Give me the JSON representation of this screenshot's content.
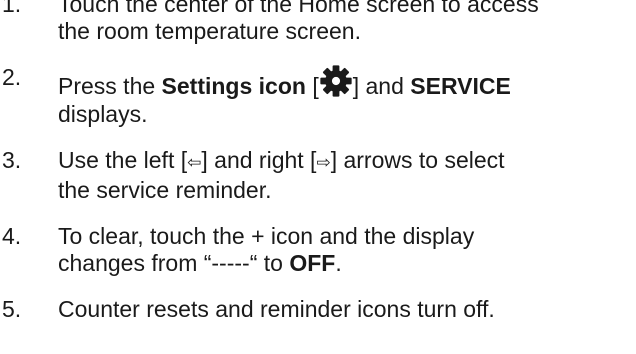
{
  "steps": [
    {
      "number": "1.",
      "line1": "Touch the center of the Home screen to access",
      "line2": "the room temperature screen."
    },
    {
      "number": "2.",
      "line1_a": "Press the ",
      "line1_bold1": "Settings icon",
      "line1_b": " [",
      "icon": "gear-icon",
      "line1_c": "] and ",
      "line1_bold2": "SERVICE",
      "line2": "displays."
    },
    {
      "number": "3.",
      "line1_a": "Use the left [",
      "left_arrow": "⇦",
      "line1_b": "] and right [",
      "right_arrow": "⇨",
      "line1_c": "] arrows to select",
      "line2": "the service reminder."
    },
    {
      "number": "4.",
      "line1": "To clear, touch the + icon and the display",
      "line2_a": "changes from “-----“ to ",
      "line2_bold": "OFF",
      "line2_b": "."
    },
    {
      "number": "5.",
      "line1": "Counter resets and reminder icons turn off."
    }
  ]
}
